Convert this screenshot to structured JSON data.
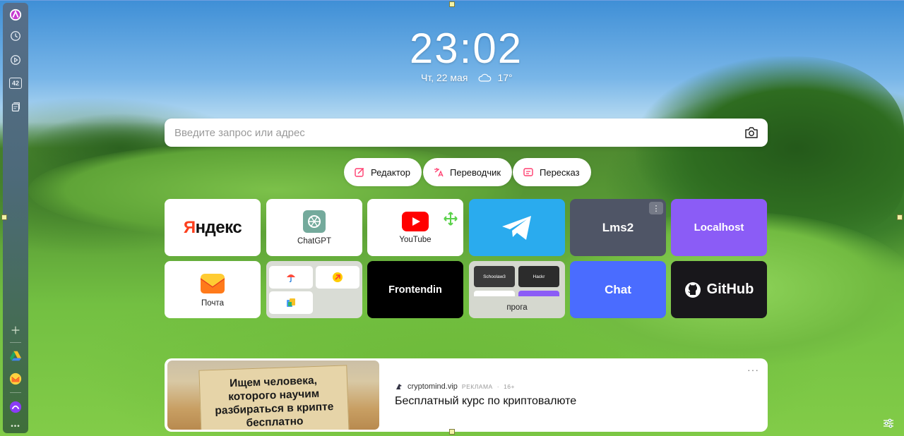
{
  "clock": {
    "time": "23:02",
    "date": "Чт, 22 мая",
    "temperature": "17°"
  },
  "search": {
    "placeholder": "Введите запрос или адрес"
  },
  "pills": [
    {
      "label": "Редактор",
      "icon": "edit-sparkle-icon"
    },
    {
      "label": "Переводчик",
      "icon": "translate-icon"
    },
    {
      "label": "Пересказ",
      "icon": "summary-icon"
    }
  ],
  "tiles": [
    {
      "label": "Яндекс",
      "type": "logo"
    },
    {
      "label": "ChatGPT",
      "type": "icon"
    },
    {
      "label": "YouTube",
      "type": "icon"
    },
    {
      "label": "",
      "type": "telegram"
    },
    {
      "label": "Lms2",
      "type": "text",
      "color": "#4f5566"
    },
    {
      "label": "Localhost",
      "type": "text",
      "color": "#8b5cf6"
    },
    {
      "label": "Почта",
      "type": "icon"
    },
    {
      "label": "",
      "type": "folder"
    },
    {
      "label": "Frontendin",
      "type": "text",
      "color": "#000000"
    },
    {
      "label": "прога",
      "type": "folder",
      "mini": [
        "Schoolaw3",
        "Hackr"
      ]
    },
    {
      "label": "Chat",
      "type": "text",
      "color": "#4a6cff"
    },
    {
      "label": "GitHub",
      "type": "logo",
      "color": "#18171b"
    }
  ],
  "ad": {
    "image_text": [
      "Ищем человека,",
      "которого научим",
      "разбираться в крипте",
      "бесплатно"
    ],
    "source": "cryptomind.vip",
    "tag": "РЕКЛАМА",
    "age": "16+",
    "title": "Бесплатный курс по криптовалюте",
    "more": "···"
  },
  "sidebar": {
    "items": [
      "alice-avatar-icon",
      "history-icon",
      "play-icon",
      "badge-42-icon",
      "collections-icon",
      "add-icon",
      "drive-icon",
      "mail-icon",
      "alice-icon",
      "more-icon"
    ],
    "badge": "42",
    "more": "•••"
  },
  "colors": {
    "accent": "#ff4a5a",
    "youtube": "#ff0000",
    "telegram": "#2aabee"
  }
}
